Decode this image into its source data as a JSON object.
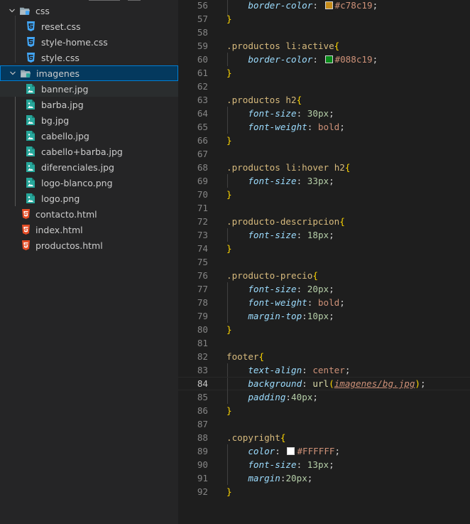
{
  "explorer": {
    "rows": [
      {
        "label": "css",
        "kind": "folder",
        "icon": "folder-css-open-icon",
        "expanded": true,
        "level": 1
      },
      {
        "label": "reset.css",
        "kind": "css",
        "icon": "css-file-icon",
        "level": 2
      },
      {
        "label": "style-home.css",
        "kind": "css",
        "icon": "css-file-icon",
        "level": 2
      },
      {
        "label": "style.css",
        "kind": "css",
        "icon": "css-file-icon",
        "level": 2
      },
      {
        "label": "imagenes",
        "kind": "folder",
        "icon": "folder-images-open-icon",
        "expanded": true,
        "level": 1,
        "selected": true
      },
      {
        "label": "banner.jpg",
        "kind": "image",
        "icon": "image-file-icon",
        "level": 2
      },
      {
        "label": "barba.jpg",
        "kind": "image",
        "icon": "image-file-icon",
        "level": 2
      },
      {
        "label": "bg.jpg",
        "kind": "image",
        "icon": "image-file-icon",
        "level": 2
      },
      {
        "label": "cabello.jpg",
        "kind": "image",
        "icon": "image-file-icon",
        "level": 2
      },
      {
        "label": "cabello+barba.jpg",
        "kind": "image",
        "icon": "image-file-icon",
        "level": 2
      },
      {
        "label": "diferenciales.jpg",
        "kind": "image",
        "icon": "image-file-icon",
        "level": 2
      },
      {
        "label": "logo-blanco.png",
        "kind": "image",
        "icon": "image-file-icon",
        "level": 2
      },
      {
        "label": "logo.png",
        "kind": "image",
        "icon": "image-file-icon",
        "level": 2
      },
      {
        "label": "contacto.html",
        "kind": "html",
        "icon": "html-file-icon",
        "level": 1
      },
      {
        "label": "index.html",
        "kind": "html",
        "icon": "html-file-icon",
        "level": 1
      },
      {
        "label": "productos.html",
        "kind": "html",
        "icon": "html-file-icon",
        "level": 1
      }
    ]
  },
  "editor": {
    "current_line": 84,
    "lines": [
      {
        "n": "56",
        "tokens": [
          [
            "    ",
            "pun"
          ],
          [
            "border-color",
            "prop"
          ],
          [
            ": ",
            "pun"
          ],
          [
            "#c78c19",
            "color",
            "#c78c19"
          ],
          [
            ";",
            "pun"
          ]
        ]
      },
      {
        "n": "57",
        "tokens": [
          [
            "}",
            "br"
          ]
        ]
      },
      {
        "n": "58",
        "tokens": []
      },
      {
        "n": "59",
        "tokens": [
          [
            ".productos",
            "sel"
          ],
          [
            " ",
            "pun"
          ],
          [
            "li",
            "tag"
          ],
          [
            ":active",
            "sel"
          ],
          [
            "{",
            "br"
          ]
        ]
      },
      {
        "n": "60",
        "tokens": [
          [
            "    ",
            "pun"
          ],
          [
            "border-color",
            "prop"
          ],
          [
            ": ",
            "pun"
          ],
          [
            "#088c19",
            "color",
            "#088c19"
          ],
          [
            ";",
            "pun"
          ]
        ]
      },
      {
        "n": "61",
        "tokens": [
          [
            "}",
            "br"
          ]
        ]
      },
      {
        "n": "62",
        "tokens": []
      },
      {
        "n": "63",
        "tokens": [
          [
            ".productos",
            "sel"
          ],
          [
            " ",
            "pun"
          ],
          [
            "h2",
            "tag"
          ],
          [
            "{",
            "br"
          ]
        ]
      },
      {
        "n": "64",
        "tokens": [
          [
            "    ",
            "pun"
          ],
          [
            "font-size",
            "prop"
          ],
          [
            ": ",
            "pun"
          ],
          [
            "30",
            "num"
          ],
          [
            "px",
            "unit"
          ],
          [
            ";",
            "pun"
          ]
        ]
      },
      {
        "n": "65",
        "tokens": [
          [
            "    ",
            "pun"
          ],
          [
            "font-weight",
            "prop"
          ],
          [
            ": ",
            "pun"
          ],
          [
            "bold",
            "kw"
          ],
          [
            ";",
            "pun"
          ]
        ]
      },
      {
        "n": "66",
        "tokens": [
          [
            "}",
            "br"
          ]
        ]
      },
      {
        "n": "67",
        "tokens": []
      },
      {
        "n": "68",
        "tokens": [
          [
            ".productos",
            "sel"
          ],
          [
            " ",
            "pun"
          ],
          [
            "li",
            "tag"
          ],
          [
            ":hover",
            "sel"
          ],
          [
            " ",
            "pun"
          ],
          [
            "h2",
            "tag"
          ],
          [
            "{",
            "br"
          ]
        ]
      },
      {
        "n": "69",
        "tokens": [
          [
            "    ",
            "pun"
          ],
          [
            "font-size",
            "prop"
          ],
          [
            ": ",
            "pun"
          ],
          [
            "33",
            "num"
          ],
          [
            "px",
            "unit"
          ],
          [
            ";",
            "pun"
          ]
        ]
      },
      {
        "n": "70",
        "tokens": [
          [
            "}",
            "br"
          ]
        ]
      },
      {
        "n": "71",
        "tokens": []
      },
      {
        "n": "72",
        "tokens": [
          [
            ".producto-descripcion",
            "sel"
          ],
          [
            "{",
            "br"
          ]
        ]
      },
      {
        "n": "73",
        "tokens": [
          [
            "    ",
            "pun"
          ],
          [
            "font-size",
            "prop"
          ],
          [
            ": ",
            "pun"
          ],
          [
            "18",
            "num"
          ],
          [
            "px",
            "unit"
          ],
          [
            ";",
            "pun"
          ]
        ]
      },
      {
        "n": "74",
        "tokens": [
          [
            "}",
            "br"
          ]
        ]
      },
      {
        "n": "75",
        "tokens": []
      },
      {
        "n": "76",
        "tokens": [
          [
            ".producto-precio",
            "sel"
          ],
          [
            "{",
            "br"
          ]
        ]
      },
      {
        "n": "77",
        "tokens": [
          [
            "    ",
            "pun"
          ],
          [
            "font-size",
            "prop"
          ],
          [
            ": ",
            "pun"
          ],
          [
            "20",
            "num"
          ],
          [
            "px",
            "unit"
          ],
          [
            ";",
            "pun"
          ]
        ]
      },
      {
        "n": "78",
        "tokens": [
          [
            "    ",
            "pun"
          ],
          [
            "font-weight",
            "prop"
          ],
          [
            ": ",
            "pun"
          ],
          [
            "bold",
            "kw"
          ],
          [
            ";",
            "pun"
          ]
        ]
      },
      {
        "n": "79",
        "tokens": [
          [
            "    ",
            "pun"
          ],
          [
            "margin-top",
            "prop"
          ],
          [
            ":",
            "pun"
          ],
          [
            "10",
            "num"
          ],
          [
            "px",
            "unit"
          ],
          [
            ";",
            "pun"
          ]
        ]
      },
      {
        "n": "80",
        "tokens": [
          [
            "}",
            "br"
          ]
        ]
      },
      {
        "n": "81",
        "tokens": []
      },
      {
        "n": "82",
        "tokens": [
          [
            "footer",
            "tag"
          ],
          [
            "{",
            "br"
          ]
        ]
      },
      {
        "n": "83",
        "tokens": [
          [
            "    ",
            "pun"
          ],
          [
            "text-align",
            "prop"
          ],
          [
            ": ",
            "pun"
          ],
          [
            "center",
            "kw"
          ],
          [
            ";",
            "pun"
          ]
        ]
      },
      {
        "n": "84",
        "tokens": [
          [
            "    ",
            "pun"
          ],
          [
            "background",
            "prop"
          ],
          [
            ": ",
            "pun"
          ],
          [
            "url",
            "fn"
          ],
          [
            "(",
            "br"
          ],
          [
            "imagenes/bg.jpg",
            "url"
          ],
          [
            ")",
            "br"
          ],
          [
            ";",
            "pun"
          ]
        ]
      },
      {
        "n": "85",
        "tokens": [
          [
            "    ",
            "pun"
          ],
          [
            "padding",
            "prop"
          ],
          [
            ":",
            "pun"
          ],
          [
            "40",
            "num"
          ],
          [
            "px",
            "unit"
          ],
          [
            ";",
            "pun"
          ]
        ]
      },
      {
        "n": "86",
        "tokens": [
          [
            "}",
            "br"
          ]
        ]
      },
      {
        "n": "87",
        "tokens": []
      },
      {
        "n": "88",
        "tokens": [
          [
            ".copyright",
            "sel"
          ],
          [
            "{",
            "br"
          ]
        ]
      },
      {
        "n": "89",
        "tokens": [
          [
            "    ",
            "pun"
          ],
          [
            "color",
            "prop"
          ],
          [
            ": ",
            "pun"
          ],
          [
            "#FFFFFF",
            "color",
            "#FFFFFF"
          ],
          [
            ";",
            "pun"
          ]
        ]
      },
      {
        "n": "90",
        "tokens": [
          [
            "    ",
            "pun"
          ],
          [
            "font-size",
            "prop"
          ],
          [
            ": ",
            "pun"
          ],
          [
            "13",
            "num"
          ],
          [
            "px",
            "unit"
          ],
          [
            ";",
            "pun"
          ]
        ]
      },
      {
        "n": "91",
        "tokens": [
          [
            "    ",
            "pun"
          ],
          [
            "margin",
            "prop"
          ],
          [
            ":",
            "pun"
          ],
          [
            "20",
            "num"
          ],
          [
            "px",
            "unit"
          ],
          [
            ";",
            "pun"
          ]
        ]
      },
      {
        "n": "92",
        "tokens": [
          [
            "}",
            "br"
          ]
        ]
      }
    ]
  },
  "colors": {
    "css_icon": "#42a5f5",
    "image_icon": "#26a69a",
    "html_icon": "#e44d26",
    "folder_icon": "#90a4ae",
    "selection_border": "#007fd4"
  }
}
